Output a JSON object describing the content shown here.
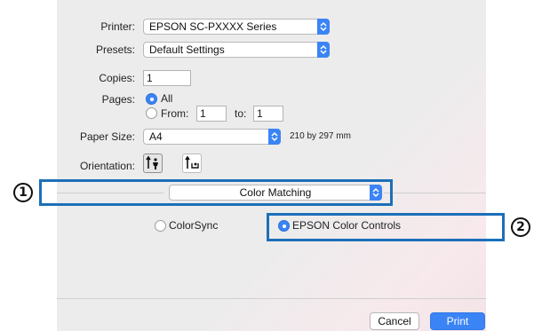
{
  "printer": {
    "label": "Printer:",
    "value": "EPSON SC-PXXXX Series"
  },
  "presets": {
    "label": "Presets:",
    "value": "Default Settings"
  },
  "copies": {
    "label": "Copies:",
    "value": "1"
  },
  "pages": {
    "label": "Pages:",
    "all_label": "All",
    "from_label": "From:",
    "from_value": "1",
    "to_label": "to:",
    "to_value": "1",
    "selected": "All"
  },
  "paper_size": {
    "label": "Paper Size:",
    "value": "A4",
    "dimensions": "210 by 297 mm"
  },
  "orientation": {
    "label": "Orientation:",
    "selected": "portrait"
  },
  "panel": {
    "value": "Color Matching"
  },
  "color_matching": {
    "colorsync_label": "ColorSync",
    "epson_label": "EPSON Color Controls",
    "selected": "EPSON Color Controls"
  },
  "buttons": {
    "cancel": "Cancel",
    "print": "Print"
  },
  "callouts": {
    "one": "1",
    "two": "2"
  },
  "colors": {
    "accent": "#3b84f5",
    "callout": "#1c6fb8"
  }
}
